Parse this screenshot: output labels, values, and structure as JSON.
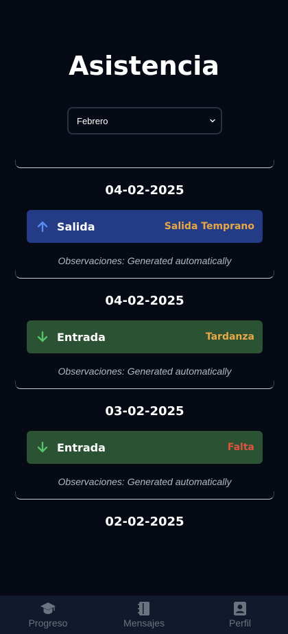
{
  "header": {
    "title": "Asistencia"
  },
  "month_select": {
    "value": "Febrero"
  },
  "records": [
    {
      "date": "04-02-2025",
      "type": "Salida",
      "kind": "salida",
      "status": "Salida Temprano",
      "status_color": "#e8a845",
      "observations": "Observaciones: Generated automatically"
    },
    {
      "date": "04-02-2025",
      "type": "Entrada",
      "kind": "entrada",
      "status": "Tardanza",
      "status_color": "#e8a845",
      "observations": "Observaciones: Generated automatically"
    },
    {
      "date": "03-02-2025",
      "type": "Entrada",
      "kind": "entrada",
      "status": "Falta",
      "status_color": "#e0533f",
      "observations": "Observaciones: Generated automatically"
    },
    {
      "date": "02-02-2025"
    }
  ],
  "tabbar": {
    "progreso": "Progreso",
    "mensajes": "Mensajes",
    "perfil": "Perfil"
  },
  "colors": {
    "background": "#050a14",
    "salida_bg": "#243b86",
    "entrada_bg": "#2a5233",
    "arrow_up": "#5b8def",
    "arrow_down": "#59c36a",
    "tabbar": "#111a2c"
  }
}
